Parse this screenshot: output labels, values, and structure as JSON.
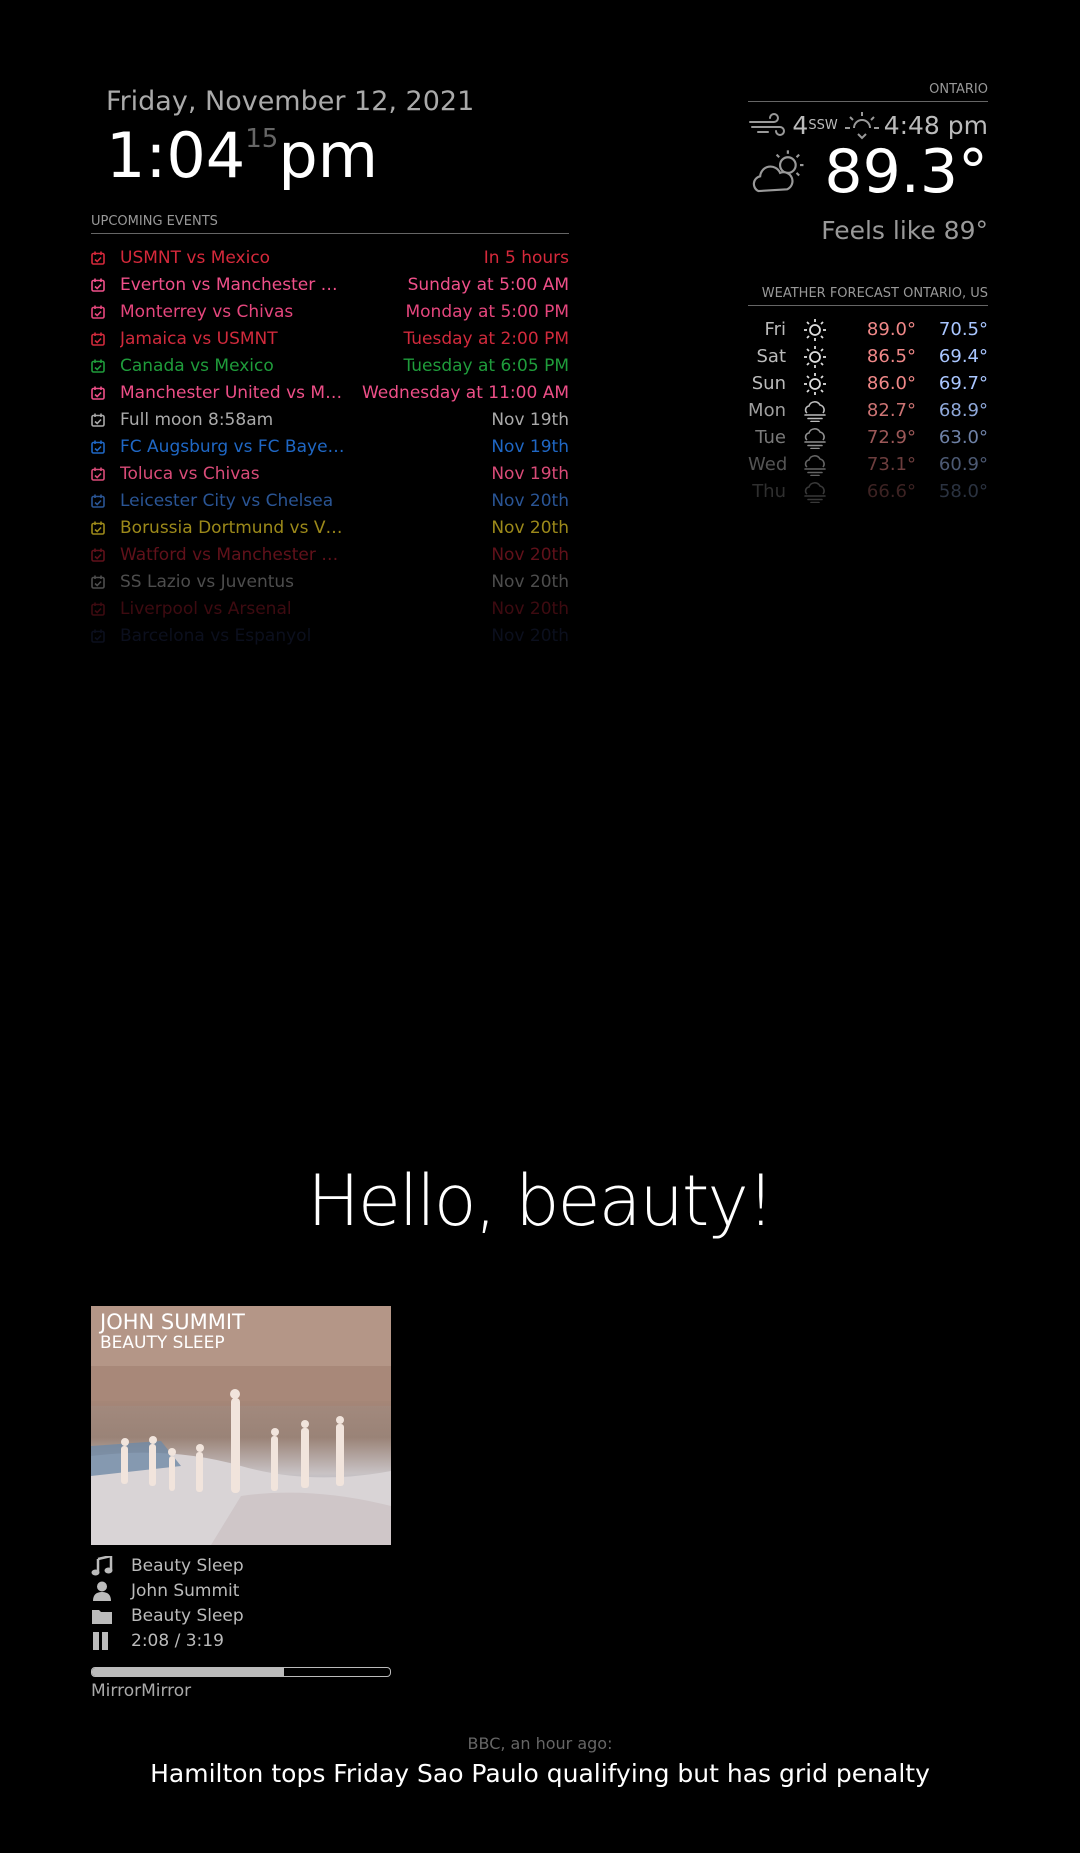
{
  "clock": {
    "date": "Friday, November 12, 2021",
    "time": "1:04",
    "seconds": "15",
    "period": "pm"
  },
  "calendar": {
    "header": "UPCOMING EVENTS",
    "events": [
      {
        "title": "USMNT vs Mexico",
        "when": "In 5 hours",
        "color": "#d6293b",
        "opacity": 1
      },
      {
        "title": "Everton vs Manchester Uni…",
        "when": "Sunday at 5:00 AM",
        "color": "#f0508a",
        "opacity": 1
      },
      {
        "title": "Monterrey vs Chivas",
        "when": "Monday at 5:00 PM",
        "color": "#e5467d",
        "opacity": 1
      },
      {
        "title": "Jamaica vs USMNT",
        "when": "Tuesday at 2:00 PM",
        "color": "#d12a3c",
        "opacity": 1
      },
      {
        "title": "Canada vs Mexico",
        "when": "Tuesday at 6:05 PM",
        "color": "#1f9c3b",
        "opacity": 1
      },
      {
        "title": "Manchester United vs Manc…",
        "when": "Wednesday at 11:00 AM",
        "color": "#ee4f88",
        "opacity": 1
      },
      {
        "title": "Full moon 8:58am",
        "when": "Nov 19th",
        "color": "#aaaaaa",
        "opacity": 1
      },
      {
        "title": "FC Augsburg vs FC Bayern …",
        "when": "Nov 19th",
        "color": "#1f67c4",
        "opacity": 1
      },
      {
        "title": "Toluca vs Chivas",
        "when": "Nov 19th",
        "color": "#d94b78",
        "opacity": 1
      },
      {
        "title": "Leicester City vs Chelsea",
        "when": "Nov 20th",
        "color": "#2f5fa6",
        "opacity": 0.9
      },
      {
        "title": "Borussia Dortmund vs VFB …",
        "when": "Nov 20th",
        "color": "#b8a21f",
        "opacity": 0.85
      },
      {
        "title": "Watford vs Manchester Uni…",
        "when": "Nov 20th",
        "color": "#b01f30",
        "opacity": 0.55
      },
      {
        "title": "SS Lazio vs Juventus",
        "when": "Nov 20th",
        "color": "#9a9a9a",
        "opacity": 0.5
      },
      {
        "title": "Liverpool vs Arsenal",
        "when": "Nov 20th",
        "color": "#b01f30",
        "opacity": 0.35
      },
      {
        "title": "Barcelona vs Espanyol",
        "when": "Nov 20th",
        "color": "#3a4a90",
        "opacity": 0.2
      }
    ]
  },
  "weather": {
    "location": "ONTARIO",
    "wind_speed": "4",
    "wind_dir": "SSW",
    "sunset": "4:48 pm",
    "temperature": "89.3°",
    "feels_like": "Feels like 89°",
    "icons": {
      "wind": "wind-icon",
      "sunset": "sunset-icon",
      "current": "partly-cloudy-icon"
    }
  },
  "forecast": {
    "header": "WEATHER FORECAST ONTARIO, US",
    "days": [
      {
        "day": "Fri",
        "icon": "sunny-icon",
        "high": "89.0°",
        "low": "70.5°",
        "opacity": 1
      },
      {
        "day": "Sat",
        "icon": "sunny-icon",
        "high": "86.5°",
        "low": "69.4°",
        "opacity": 1
      },
      {
        "day": "Sun",
        "icon": "sunny-icon",
        "high": "86.0°",
        "low": "69.7°",
        "opacity": 1
      },
      {
        "day": "Mon",
        "icon": "cloudy-wind-icon",
        "high": "82.7°",
        "low": "68.9°",
        "opacity": 0.85
      },
      {
        "day": "Tue",
        "icon": "cloudy-wind-icon",
        "high": "72.9°",
        "low": "63.0°",
        "opacity": 0.65
      },
      {
        "day": "Wed",
        "icon": "cloudy-wind-icon",
        "high": "73.1°",
        "low": "60.9°",
        "opacity": 0.45
      },
      {
        "day": "Thu",
        "icon": "cloudy-wind-icon",
        "high": "66.6°",
        "low": "58.0°",
        "opacity": 0.25
      }
    ]
  },
  "compliment": "Hello, beauty!",
  "now_playing": {
    "album_art_text_line1": "JOHN SUMMIT",
    "album_art_text_line2": "BEAUTY SLEEP",
    "track": "Beauty Sleep",
    "artist": "John Summit",
    "album": "Beauty Sleep",
    "time": "2:08 / 3:19",
    "progress": 0.645,
    "device": "MirrorMirror",
    "icons": {
      "track": "music-note-icon",
      "artist": "user-icon",
      "album": "folder-icon",
      "state": "pause-icon"
    }
  },
  "news": {
    "source": "BBC, an hour ago:",
    "headline": "Hamilton tops Friday Sao Paulo qualifying but has grid penalty"
  }
}
